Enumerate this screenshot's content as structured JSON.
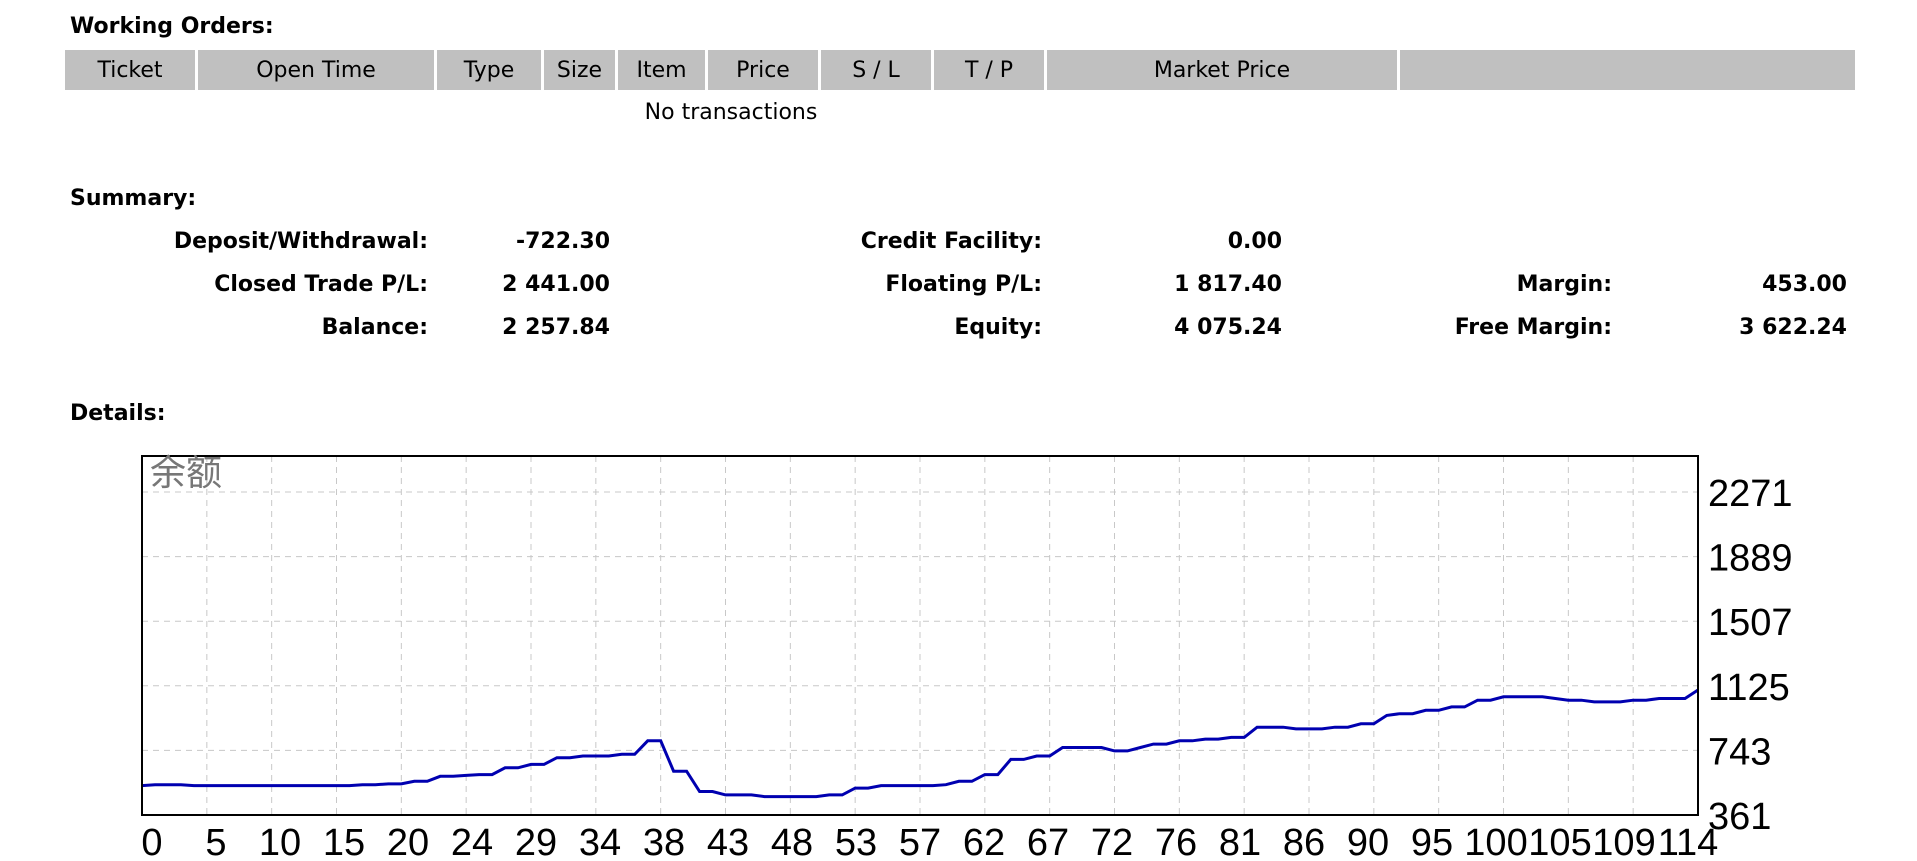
{
  "working_orders": {
    "title": "Working Orders:",
    "columns": [
      "Ticket",
      "Open Time",
      "Type",
      "Size",
      "Item",
      "Price",
      "S / L",
      "T / P",
      "Market Price",
      ""
    ],
    "empty_text": "No transactions"
  },
  "summary": {
    "title": "Summary:",
    "deposit_withdrawal_label": "Deposit/Withdrawal:",
    "deposit_withdrawal_value": "-722.30",
    "credit_facility_label": "Credit Facility:",
    "credit_facility_value": "0.00",
    "closed_pl_label": "Closed Trade P/L:",
    "closed_pl_value": "2 441.00",
    "floating_pl_label": "Floating P/L:",
    "floating_pl_value": "1 817.40",
    "margin_label": "Margin:",
    "margin_value": "453.00",
    "balance_label": "Balance:",
    "balance_value": "2 257.84",
    "equity_label": "Equity:",
    "equity_value": "4 075.24",
    "free_margin_label": "Free Margin:",
    "free_margin_value": "3 622.24"
  },
  "details": {
    "title": "Details:"
  },
  "chart_data": {
    "type": "line",
    "title": "余额",
    "line_color": "#0000b0",
    "grid": true,
    "x_ticks": [
      "0",
      "5",
      "10",
      "15",
      "20",
      "24",
      "29",
      "34",
      "38",
      "43",
      "48",
      "53",
      "57",
      "62",
      "67",
      "72",
      "76",
      "81",
      "86",
      "90",
      "95",
      "100",
      "105",
      "109",
      "114"
    ],
    "y_ticks": [
      "2271",
      "1889",
      "1507",
      "1125",
      "743",
      "361"
    ],
    "xlim": [
      0,
      120
    ],
    "ylim": [
      361,
      2271
    ],
    "x": [
      0,
      1,
      3,
      4,
      6,
      8,
      9,
      11,
      12,
      13,
      14,
      15,
      16,
      17,
      18,
      19,
      20,
      21,
      22,
      23,
      24,
      25,
      26,
      27,
      28,
      29,
      30,
      31,
      32,
      33,
      34,
      35,
      36,
      37,
      38,
      39,
      40,
      41,
      42,
      43,
      44,
      45,
      46,
      47,
      48,
      49,
      50,
      51,
      52,
      53,
      54,
      55,
      56,
      57,
      58,
      59,
      60,
      61,
      62,
      63,
      64,
      65,
      66,
      67,
      68,
      69,
      70,
      71,
      72,
      73,
      74,
      75,
      76,
      77,
      78,
      79,
      80,
      81,
      82,
      83,
      84,
      85,
      86,
      87,
      88,
      89,
      90,
      91,
      92,
      93,
      94,
      95,
      96,
      97,
      98,
      99,
      100,
      101,
      102,
      103,
      104,
      105,
      106,
      107,
      108,
      109,
      110,
      111,
      112,
      113,
      114,
      115,
      116,
      117,
      118,
      119,
      120
    ],
    "y": [
      535,
      540,
      540,
      535,
      535,
      535,
      535,
      535,
      535,
      535,
      535,
      535,
      535,
      540,
      540,
      545,
      545,
      560,
      560,
      590,
      590,
      595,
      600,
      600,
      640,
      640,
      660,
      660,
      700,
      700,
      710,
      710,
      710,
      720,
      720,
      800,
      800,
      620,
      620,
      500,
      500,
      480,
      480,
      480,
      470,
      470,
      470,
      470,
      470,
      480,
      480,
      520,
      520,
      535,
      535,
      535,
      535,
      535,
      540,
      560,
      560,
      600,
      600,
      690,
      690,
      710,
      710,
      760,
      760,
      760,
      760,
      740,
      740,
      760,
      780,
      780,
      800,
      800,
      810,
      810,
      820,
      820,
      880,
      880,
      880,
      870,
      870,
      870,
      880,
      880,
      900,
      900,
      950,
      960,
      960,
      980,
      980,
      1000,
      1000,
      1040,
      1040,
      1060,
      1060,
      1060,
      1060,
      1050,
      1040,
      1040,
      1030,
      1030,
      1030,
      1040,
      1040,
      1050,
      1050,
      1050,
      1100
    ]
  }
}
